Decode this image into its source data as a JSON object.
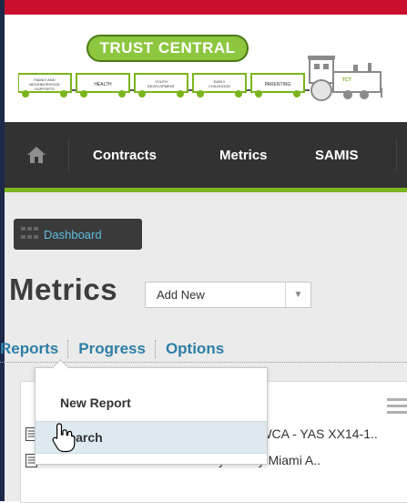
{
  "logo": {
    "banner_text": "TRUST CENTRAL"
  },
  "train_cars": [
    "FAMILY AND NEIGHBORHOOD SUPPORTS",
    "HEALTH",
    "YOUTH DEVELOPMENT",
    "EARLY CHILDHOOD",
    "PARENTING"
  ],
  "nav": {
    "home_icon": "home-icon",
    "items": [
      "Contracts",
      "Metrics",
      "SAMIS"
    ]
  },
  "dashboard_button": {
    "label": "Dashboard",
    "icon": "grid-icon"
  },
  "page": {
    "title": "Metrics",
    "add_select": {
      "value": "Add New",
      "caret_icon": "chevron-down-icon"
    }
  },
  "tabs": [
    "Reports",
    "Progress",
    "Options"
  ],
  "dropdown": {
    "items": [
      "New Report",
      "Search"
    ],
    "active_index": 1
  },
  "list": {
    "rows": [
      {
        "text": "YWCA - YAS XX14-1..",
        "icon": "document-icon"
      },
      {
        "text": "CAT - YAS Observation Tool: My Sunny Miami A..",
        "icon": "document-icon"
      }
    ]
  },
  "colors": {
    "brand_green": "#7ab51d",
    "nav_bg": "#323232",
    "top_strip": "#c8102e",
    "link_blue": "#2d7fa6",
    "dashboard_text": "#5fbfdf"
  }
}
